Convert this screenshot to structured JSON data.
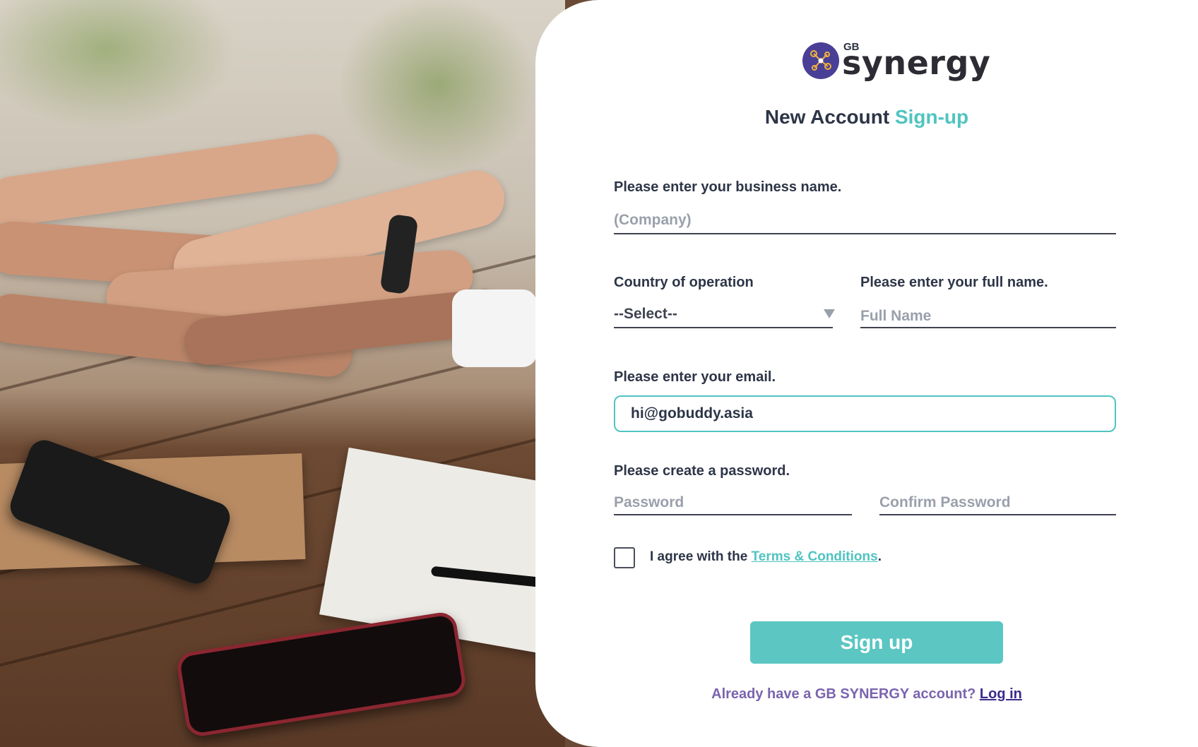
{
  "logo": {
    "prefix": "GB",
    "word": "synergy",
    "icon": "network-nodes-icon",
    "badge_color": "#4a3f97"
  },
  "heading": {
    "main": "New Account",
    "accent": "Sign-up",
    "accent_color": "#4fc4c0"
  },
  "form": {
    "business": {
      "label": "Please enter your business name.",
      "placeholder": "(Company)"
    },
    "country": {
      "label": "Country of operation",
      "selected": "--Select--",
      "icon": "triangle-down-icon"
    },
    "fullname": {
      "label": "Please enter your full name.",
      "placeholder": "Full Name"
    },
    "email": {
      "label": "Please enter your email.",
      "value": "hi@gobuddy.asia"
    },
    "password": {
      "label": "Please create a password.",
      "placeholder": "Password",
      "confirm_placeholder": "Confirm Password"
    },
    "terms": {
      "checked": false,
      "prefix": "I agree with the ",
      "link": "Terms & Conditions",
      "suffix": "."
    },
    "submit_label": "Sign up",
    "submit_color": "#5bc6c2"
  },
  "footer": {
    "question": "Already have a GB SYNERGY account? ",
    "login_link": "Log in"
  }
}
